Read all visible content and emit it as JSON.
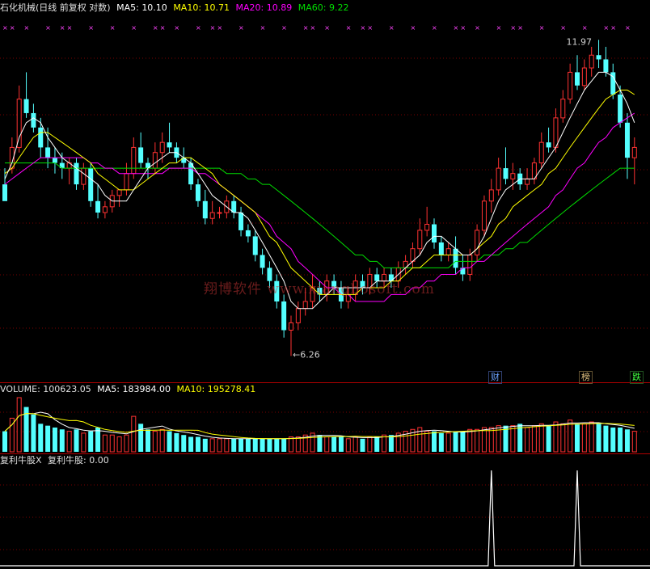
{
  "header": {
    "stock": "石化机械(日线 前复权 对数)",
    "ma5_label": "MA5:",
    "ma5_value": "10.10",
    "ma10_label": "MA10:",
    "ma10_value": "10.71",
    "ma20_label": "MA20:",
    "ma20_value": "10.89",
    "ma60_label": "MA60:",
    "ma60_value": "9.22"
  },
  "volume_header": {
    "label": "VOLUME:",
    "value": "100623.05",
    "ma5_label": "MA5:",
    "ma5_value": "183984.00",
    "ma10_label": "MA10:",
    "ma10_value": "195278.41"
  },
  "indicator_header": {
    "name": "复利牛股X",
    "label": "复利牛股:",
    "value": "0.00"
  },
  "watermark": "翔博软件 www.xiangbosoft.com",
  "annotations": {
    "high": "11.97",
    "low": "6.26"
  },
  "tags": {
    "cai": "财",
    "bang": "榜",
    "die": "跌"
  },
  "colors": {
    "up": "#ff3232",
    "down": "#54ffff",
    "ma5": "#ffffff",
    "ma10": "#ffff00",
    "ma20": "#ff00ff",
    "ma60": "#00dd00",
    "grid": "#7a0000",
    "marker": "#ff44ff"
  },
  "chart_data": {
    "type": "candlestick",
    "scale": "log",
    "ylim": [
      6.0,
      12.4
    ],
    "price_high": 11.97,
    "price_low": 6.26,
    "candles": [
      [
        8.9,
        9.2,
        8.7,
        8.6
      ],
      [
        9.2,
        9.8,
        9.1,
        9.6
      ],
      [
        9.6,
        10.9,
        9.5,
        10.6
      ],
      [
        10.6,
        11.2,
        10.2,
        10.3
      ],
      [
        10.3,
        10.5,
        9.9,
        10.0
      ],
      [
        10.0,
        10.2,
        9.4,
        9.6
      ],
      [
        9.6,
        10.0,
        9.2,
        9.4
      ],
      [
        9.4,
        9.6,
        9.1,
        9.3
      ],
      [
        9.3,
        9.5,
        9.0,
        9.2
      ],
      [
        9.2,
        9.4,
        8.9,
        9.3
      ],
      [
        9.3,
        9.4,
        8.8,
        8.9
      ],
      [
        8.9,
        9.3,
        8.8,
        9.2
      ],
      [
        9.2,
        9.3,
        8.5,
        8.6
      ],
      [
        8.6,
        8.9,
        8.3,
        8.4
      ],
      [
        8.4,
        8.6,
        8.3,
        8.5
      ],
      [
        8.5,
        8.8,
        8.4,
        8.7
      ],
      [
        8.7,
        8.8,
        8.5,
        8.8
      ],
      [
        8.8,
        9.3,
        8.7,
        9.1
      ],
      [
        9.1,
        9.8,
        9.0,
        9.6
      ],
      [
        9.6,
        9.9,
        9.2,
        9.3
      ],
      [
        9.3,
        9.4,
        9.0,
        9.2
      ],
      [
        9.2,
        9.7,
        9.1,
        9.5
      ],
      [
        9.5,
        9.9,
        9.3,
        9.7
      ],
      [
        9.7,
        10.1,
        9.5,
        9.6
      ],
      [
        9.6,
        9.7,
        9.3,
        9.4
      ],
      [
        9.4,
        9.6,
        9.2,
        9.3
      ],
      [
        9.3,
        9.4,
        8.8,
        8.9
      ],
      [
        8.9,
        9.0,
        8.5,
        8.6
      ],
      [
        8.6,
        8.8,
        8.2,
        8.3
      ],
      [
        8.3,
        8.6,
        8.2,
        8.4
      ],
      [
        8.4,
        8.5,
        8.3,
        8.4
      ],
      [
        8.4,
        8.7,
        8.3,
        8.6
      ],
      [
        8.6,
        8.7,
        8.3,
        8.4
      ],
      [
        8.4,
        8.5,
        8.0,
        8.1
      ],
      [
        8.1,
        8.2,
        7.9,
        8.0
      ],
      [
        8.0,
        8.1,
        7.6,
        7.7
      ],
      [
        7.7,
        7.8,
        7.4,
        7.5
      ],
      [
        7.5,
        7.6,
        7.2,
        7.3
      ],
      [
        7.3,
        7.4,
        6.9,
        7.0
      ],
      [
        7.0,
        7.1,
        6.5,
        6.6
      ],
      [
        6.6,
        6.8,
        6.26,
        6.7
      ],
      [
        6.7,
        7.0,
        6.6,
        6.9
      ],
      [
        6.9,
        7.2,
        6.8,
        7.0
      ],
      [
        7.0,
        7.4,
        6.9,
        7.2
      ],
      [
        7.2,
        7.3,
        7.0,
        7.1
      ],
      [
        7.1,
        7.4,
        7.0,
        7.3
      ],
      [
        7.3,
        7.4,
        7.1,
        7.2
      ],
      [
        7.2,
        7.3,
        6.9,
        7.0
      ],
      [
        7.0,
        7.2,
        6.9,
        7.1
      ],
      [
        7.1,
        7.4,
        7.0,
        7.3
      ],
      [
        7.3,
        7.4,
        7.1,
        7.2
      ],
      [
        7.2,
        7.5,
        7.1,
        7.4
      ],
      [
        7.4,
        7.5,
        7.2,
        7.3
      ],
      [
        7.3,
        7.5,
        7.2,
        7.4
      ],
      [
        7.4,
        7.5,
        7.2,
        7.3
      ],
      [
        7.3,
        7.6,
        7.2,
        7.5
      ],
      [
        7.5,
        7.7,
        7.4,
        7.6
      ],
      [
        7.6,
        7.9,
        7.5,
        7.8
      ],
      [
        7.8,
        8.3,
        7.7,
        8.1
      ],
      [
        8.1,
        8.5,
        8.0,
        8.2
      ],
      [
        8.2,
        8.3,
        7.8,
        7.9
      ],
      [
        7.9,
        8.0,
        7.6,
        7.7
      ],
      [
        7.7,
        7.9,
        7.6,
        7.8
      ],
      [
        7.8,
        8.0,
        7.4,
        7.5
      ],
      [
        7.5,
        7.7,
        7.3,
        7.4
      ],
      [
        7.4,
        7.8,
        7.3,
        7.7
      ],
      [
        7.7,
        8.2,
        7.6,
        8.1
      ],
      [
        8.1,
        8.7,
        8.0,
        8.6
      ],
      [
        8.6,
        9.0,
        8.4,
        8.8
      ],
      [
        8.8,
        9.4,
        8.7,
        9.2
      ],
      [
        9.2,
        9.6,
        8.9,
        9.0
      ],
      [
        9.0,
        9.3,
        8.8,
        9.1
      ],
      [
        9.1,
        9.2,
        8.8,
        8.9
      ],
      [
        8.9,
        9.2,
        8.8,
        9.0
      ],
      [
        9.0,
        9.4,
        8.9,
        9.3
      ],
      [
        9.3,
        9.9,
        9.2,
        9.7
      ],
      [
        9.7,
        10.0,
        9.5,
        9.6
      ],
      [
        9.6,
        10.4,
        9.5,
        10.2
      ],
      [
        10.2,
        10.8,
        10.1,
        10.6
      ],
      [
        10.6,
        11.4,
        10.5,
        11.2
      ],
      [
        11.2,
        11.6,
        10.8,
        10.9
      ],
      [
        10.9,
        11.5,
        10.8,
        11.3
      ],
      [
        11.3,
        11.8,
        11.1,
        11.6
      ],
      [
        11.6,
        11.97,
        11.3,
        11.5
      ],
      [
        11.5,
        11.8,
        11.1,
        11.2
      ],
      [
        11.2,
        11.4,
        10.6,
        10.7
      ],
      [
        10.7,
        10.9,
        10.0,
        10.1
      ],
      [
        10.1,
        10.3,
        9.0,
        9.4
      ],
      [
        9.4,
        9.8,
        8.9,
        9.6
      ]
    ],
    "volume": [
      22,
      36,
      58,
      48,
      40,
      30,
      28,
      26,
      24,
      22,
      24,
      20,
      22,
      26,
      18,
      18,
      16,
      18,
      38,
      30,
      24,
      22,
      24,
      22,
      20,
      18,
      16,
      16,
      14,
      14,
      14,
      14,
      14,
      14,
      14,
      14,
      14,
      14,
      14,
      14,
      16,
      16,
      18,
      20,
      18,
      16,
      16,
      16,
      14,
      16,
      14,
      16,
      16,
      18,
      18,
      20,
      22,
      24,
      26,
      22,
      22,
      20,
      20,
      22,
      22,
      24,
      24,
      26,
      26,
      28,
      28,
      28,
      30,
      26,
      28,
      30,
      28,
      32,
      30,
      34,
      30,
      30,
      32,
      30,
      28,
      26,
      26,
      24,
      22
    ],
    "ma5": [
      9.0,
      9.3,
      9.8,
      10.1,
      10.2,
      10.1,
      9.8,
      9.6,
      9.4,
      9.3,
      9.2,
      9.1,
      9.0,
      8.9,
      8.7,
      8.6,
      8.6,
      8.6,
      8.8,
      9.0,
      9.2,
      9.3,
      9.4,
      9.5,
      9.5,
      9.4,
      9.3,
      9.1,
      8.9,
      8.7,
      8.6,
      8.5,
      8.4,
      8.4,
      8.3,
      8.1,
      7.9,
      7.7,
      7.5,
      7.3,
      7.0,
      6.9,
      6.9,
      6.9,
      7.0,
      7.1,
      7.2,
      7.2,
      7.2,
      7.2,
      7.2,
      7.2,
      7.3,
      7.3,
      7.3,
      7.4,
      7.5,
      7.6,
      7.7,
      7.9,
      8.0,
      8.0,
      7.9,
      7.8,
      7.7,
      7.7,
      7.8,
      8.0,
      8.3,
      8.6,
      8.8,
      8.9,
      9.0,
      9.0,
      9.0,
      9.2,
      9.4,
      9.6,
      9.9,
      10.2,
      10.5,
      10.8,
      11.0,
      11.2,
      11.2,
      11.1,
      10.8,
      10.5,
      10.1
    ],
    "ma10": [
      9.1,
      9.2,
      9.4,
      9.6,
      9.8,
      9.9,
      9.9,
      9.8,
      9.7,
      9.6,
      9.5,
      9.4,
      9.3,
      9.1,
      9.0,
      8.9,
      8.8,
      8.8,
      8.8,
      8.9,
      9.0,
      9.1,
      9.2,
      9.3,
      9.3,
      9.4,
      9.4,
      9.3,
      9.2,
      9.1,
      8.9,
      8.8,
      8.7,
      8.6,
      8.5,
      8.4,
      8.2,
      8.0,
      7.9,
      7.7,
      7.5,
      7.4,
      7.3,
      7.2,
      7.1,
      7.1,
      7.1,
      7.1,
      7.1,
      7.1,
      7.2,
      7.2,
      7.2,
      7.2,
      7.3,
      7.3,
      7.4,
      7.5,
      7.5,
      7.6,
      7.7,
      7.7,
      7.7,
      7.7,
      7.7,
      7.7,
      7.8,
      7.9,
      8.0,
      8.2,
      8.3,
      8.5,
      8.6,
      8.7,
      8.8,
      8.9,
      9.1,
      9.2,
      9.4,
      9.6,
      9.8,
      10.0,
      10.2,
      10.4,
      10.6,
      10.7,
      10.8,
      10.8,
      10.7
    ],
    "ma20": [
      8.9,
      9.0,
      9.1,
      9.2,
      9.3,
      9.4,
      9.4,
      9.4,
      9.4,
      9.4,
      9.4,
      9.4,
      9.3,
      9.3,
      9.2,
      9.2,
      9.1,
      9.1,
      9.1,
      9.1,
      9.1,
      9.1,
      9.1,
      9.2,
      9.2,
      9.2,
      9.2,
      9.1,
      9.1,
      9.0,
      8.9,
      8.8,
      8.7,
      8.6,
      8.5,
      8.4,
      8.3,
      8.2,
      8.0,
      7.9,
      7.8,
      7.6,
      7.5,
      7.4,
      7.3,
      7.2,
      7.2,
      7.1,
      7.1,
      7.0,
      7.0,
      7.0,
      7.0,
      7.0,
      7.1,
      7.1,
      7.1,
      7.2,
      7.2,
      7.3,
      7.3,
      7.4,
      7.4,
      7.4,
      7.5,
      7.5,
      7.6,
      7.6,
      7.7,
      7.8,
      7.9,
      8.0,
      8.1,
      8.2,
      8.3,
      8.4,
      8.5,
      8.7,
      8.8,
      9.0,
      9.2,
      9.3,
      9.5,
      9.7,
      9.8,
      10.0,
      10.1,
      10.2,
      10.3
    ],
    "ma60": [
      9.3,
      9.3,
      9.3,
      9.3,
      9.3,
      9.3,
      9.3,
      9.3,
      9.2,
      9.2,
      9.2,
      9.2,
      9.2,
      9.2,
      9.2,
      9.2,
      9.2,
      9.2,
      9.2,
      9.2,
      9.2,
      9.2,
      9.2,
      9.2,
      9.2,
      9.2,
      9.2,
      9.2,
      9.2,
      9.2,
      9.2,
      9.1,
      9.1,
      9.1,
      9.0,
      9.0,
      8.9,
      8.9,
      8.8,
      8.7,
      8.6,
      8.5,
      8.4,
      8.3,
      8.2,
      8.1,
      8.0,
      7.9,
      7.8,
      7.7,
      7.7,
      7.6,
      7.6,
      7.5,
      7.5,
      7.5,
      7.5,
      7.5,
      7.5,
      7.5,
      7.5,
      7.5,
      7.5,
      7.6,
      7.6,
      7.6,
      7.6,
      7.7,
      7.7,
      7.7,
      7.8,
      7.8,
      7.9,
      7.9,
      8.0,
      8.1,
      8.2,
      8.3,
      8.4,
      8.5,
      8.6,
      8.7,
      8.8,
      8.9,
      9.0,
      9.1,
      9.2,
      9.2,
      9.2
    ],
    "indicator_spikes": [
      68,
      80
    ]
  }
}
